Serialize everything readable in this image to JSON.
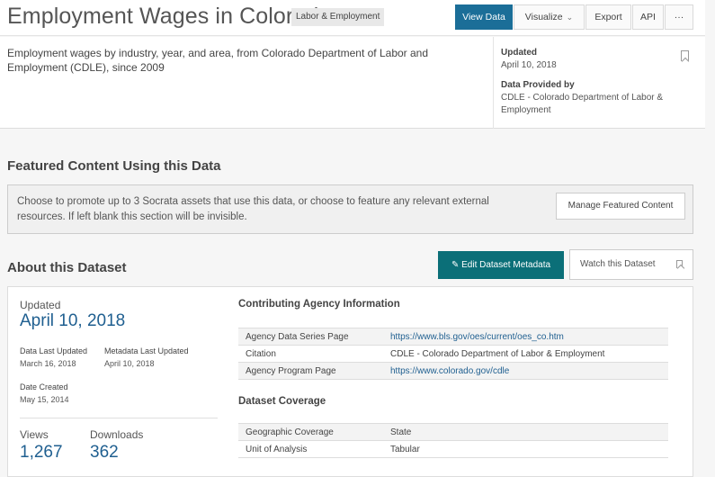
{
  "header": {
    "title": "Employment Wages in Colorado",
    "category": "Labor & Employment",
    "buttons": {
      "view_data": "View Data",
      "visualize": "Visualize",
      "export": "Export",
      "api": "API",
      "more": "···"
    }
  },
  "description": "Employment wages by industry, year, and area, from Colorado Department of Labor and Employment (CDLE), since 2009",
  "meta": {
    "updated_label": "Updated",
    "updated_value": "April 10, 2018",
    "provided_label": "Data Provided by",
    "provided_value": "CDLE - Colorado Department of Labor & Employment"
  },
  "featured": {
    "title": "Featured Content Using this Data",
    "text": "Choose to promote up to 3 Socrata assets that use this data, or choose to feature any relevant external resources. If left blank this section will be invisible.",
    "manage_button": "Manage Featured Content"
  },
  "about": {
    "title": "About this Dataset",
    "edit_button": "Edit Dataset Metadata",
    "watch_button": "Watch this Dataset",
    "updated_label": "Updated",
    "updated_value": "April 10, 2018",
    "data_last_updated_label": "Data Last Updated",
    "data_last_updated_value": "March 16, 2018",
    "metadata_last_updated_label": "Metadata Last Updated",
    "metadata_last_updated_value": "April 10, 2018",
    "date_created_label": "Date Created",
    "date_created_value": "May 15, 2014",
    "views_label": "Views",
    "views_value": "1,267",
    "downloads_label": "Downloads",
    "downloads_value": "362"
  },
  "agency": {
    "title": "Contributing Agency Information",
    "rows": [
      {
        "key": "Agency Data Series Page",
        "value": "https://www.bls.gov/oes/current/oes_co.htm"
      },
      {
        "key": "Citation",
        "value": "CDLE - Colorado Department of Labor & Employment"
      },
      {
        "key": "Agency Program Page",
        "value": "https://www.colorado.gov/cdle"
      }
    ]
  },
  "coverage": {
    "title": "Dataset Coverage",
    "rows": [
      {
        "key": "Geographic Coverage",
        "value": "State"
      },
      {
        "key": "Unit of Analysis",
        "value": "Tabular"
      }
    ]
  }
}
